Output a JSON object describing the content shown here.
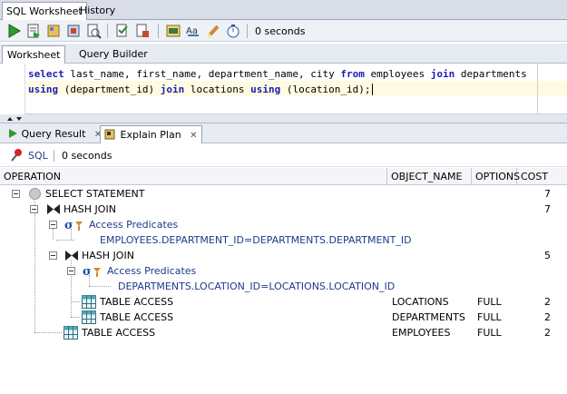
{
  "top_tabs": [
    "SQL Worksheet",
    "History"
  ],
  "toolbar": {
    "timer": "0 seconds"
  },
  "sub_tabs": [
    "Worksheet",
    "Query Builder"
  ],
  "editor": {
    "line1": [
      {
        "t": "select",
        "kw": true
      },
      {
        "t": " last_name, first_name, department_name, city ",
        "kw": false
      },
      {
        "t": "from",
        "kw": true
      },
      {
        "t": " employees ",
        "kw": false
      },
      {
        "t": "join",
        "kw": true
      },
      {
        "t": " departments",
        "kw": false
      }
    ],
    "line2": [
      {
        "t": "using",
        "kw": true
      },
      {
        "t": " (department_id) ",
        "kw": false
      },
      {
        "t": "join",
        "kw": true
      },
      {
        "t": " locations ",
        "kw": false
      },
      {
        "t": "using",
        "kw": true
      },
      {
        "t": " (location_id);",
        "kw": false
      }
    ]
  },
  "result_tabs": [
    "Query Result",
    "Explain Plan"
  ],
  "result_toolbar": {
    "sql_label": "SQL",
    "timer": "0 seconds"
  },
  "columns": [
    "OPERATION",
    "OBJECT_NAME",
    "OPTIONS",
    "COST"
  ],
  "plan_rows": [
    {
      "operation": "SELECT STATEMENT",
      "object": "",
      "options": "",
      "cost": "7"
    },
    {
      "operation": "HASH JOIN",
      "object": "",
      "options": "",
      "cost": "7"
    },
    {
      "operation": "Access Predicates",
      "object": "",
      "options": "",
      "cost": ""
    },
    {
      "operation": "EMPLOYEES.DEPARTMENT_ID=DEPARTMENTS.DEPARTMENT_ID",
      "object": "",
      "options": "",
      "cost": ""
    },
    {
      "operation": "HASH JOIN",
      "object": "",
      "options": "",
      "cost": "5"
    },
    {
      "operation": "Access Predicates",
      "object": "",
      "options": "",
      "cost": ""
    },
    {
      "operation": "DEPARTMENTS.LOCATION_ID=LOCATIONS.LOCATION_ID",
      "object": "",
      "options": "",
      "cost": ""
    },
    {
      "operation": "TABLE ACCESS",
      "object": "LOCATIONS",
      "options": "FULL",
      "cost": "2"
    },
    {
      "operation": "TABLE ACCESS",
      "object": "DEPARTMENTS",
      "options": "FULL",
      "cost": "2"
    },
    {
      "operation": "TABLE ACCESS",
      "object": "EMPLOYEES",
      "options": "FULL",
      "cost": "2"
    }
  ]
}
